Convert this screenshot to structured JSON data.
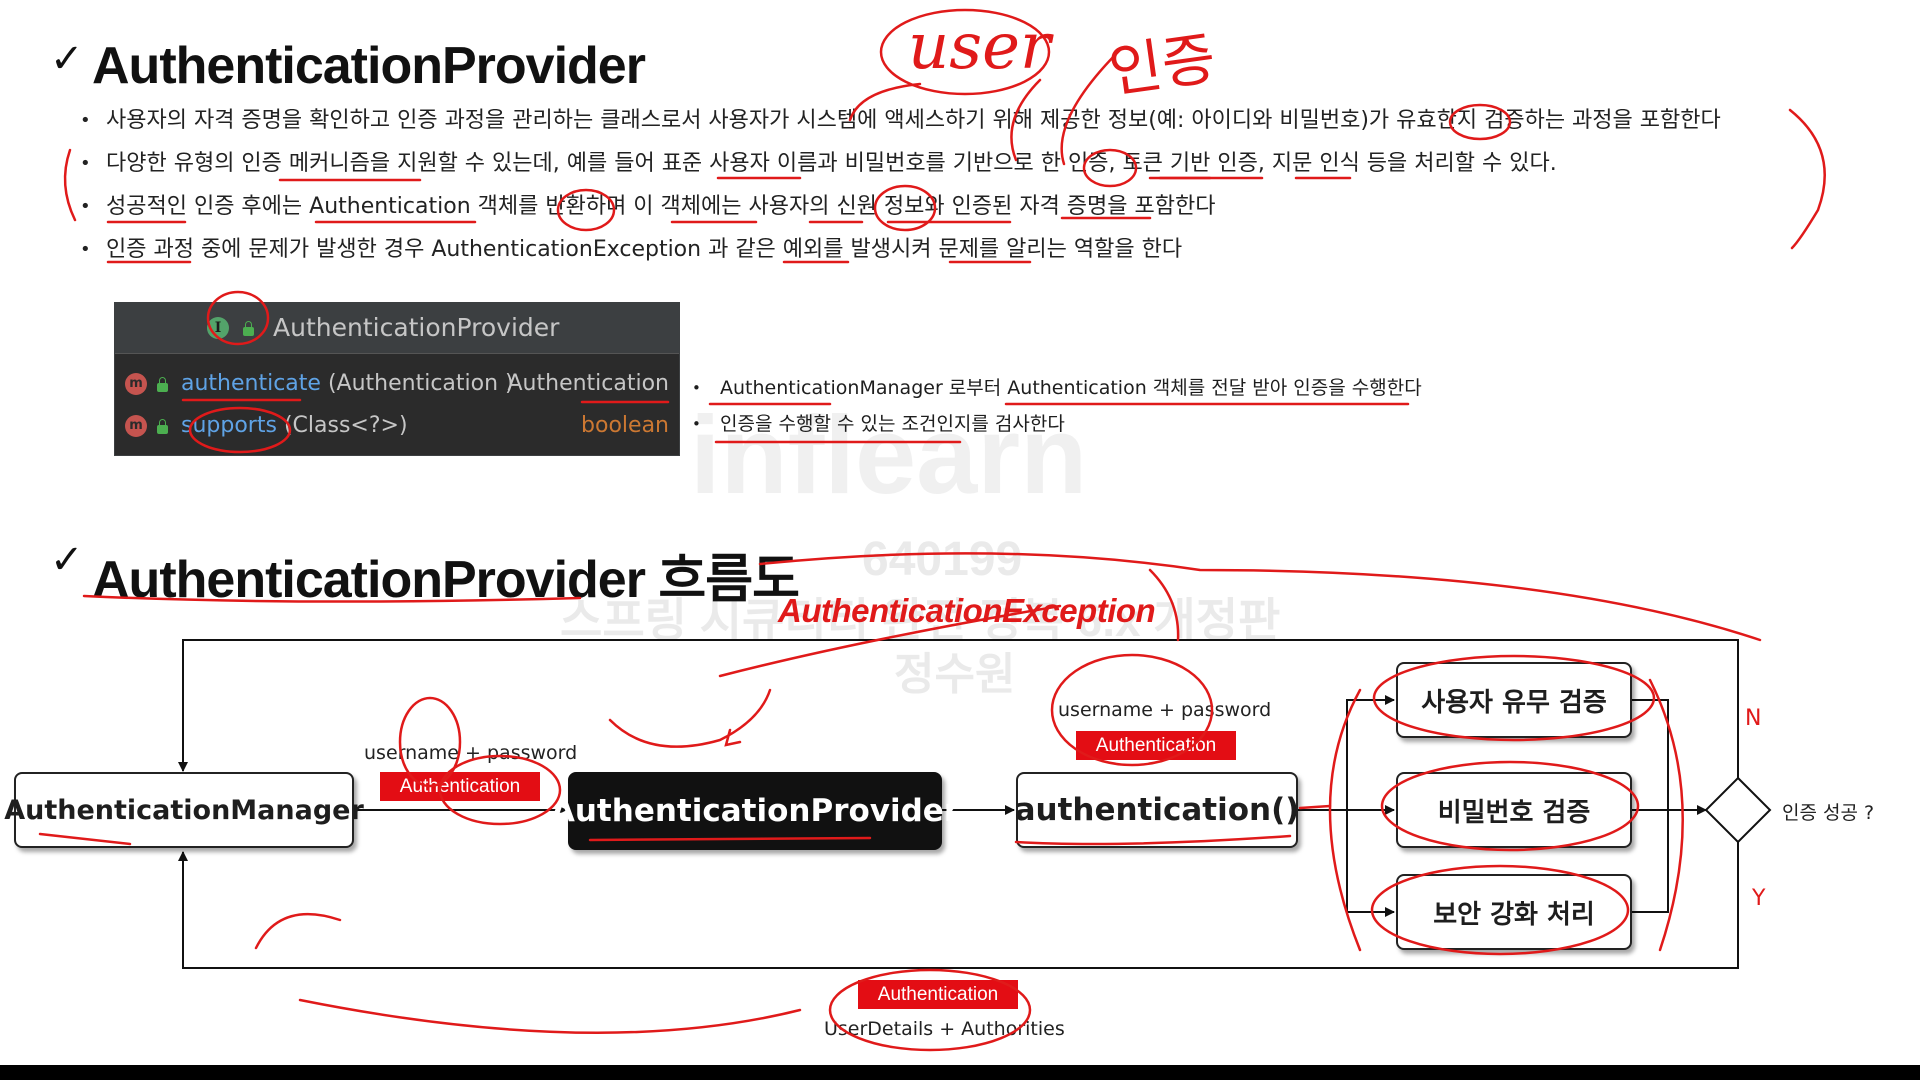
{
  "section1": {
    "title": "AuthenticationProvider",
    "bullets": [
      "사용자의 자격 증명을 확인하고 인증 과정을 관리하는 클래스로서  사용자가 시스템에 액세스하기 위해 제공한 정보(예: 아이디와 비밀번호)가 유효한지 검증하는 과정을 포함한다",
      "다양한 유형의 인증 메커니즘을 지원할 수 있는데, 예를 들어 표준 사용자 이름과 비밀번호를 기반으로 한 인증, 토큰 기반 인증, 지문 인식 등을 처리할 수 있다.",
      "성공적인 인증 후에는 Authentication 객체를 반환하며 이 객체에는 사용자의 신원 정보와 인증된 자격 증명을 포함한다",
      "인증 과정 중에 문제가 발생한 경우 AuthenticationException 과 같은 예외를 발생시켜 문제를 알리는 역할을 한다"
    ]
  },
  "ide": {
    "class_icon": "I",
    "method_icon": "m",
    "title": "AuthenticationProvider",
    "methods": [
      {
        "name": "authenticate",
        "params": "(Authentication )",
        "returns": "Authentication"
      },
      {
        "name": "supports",
        "params": "(Class<?>)",
        "returns": "boolean"
      }
    ],
    "descriptions": [
      "AuthenticationManager 로부터 Authentication 객체를 전달 받아 인증을 수행한다",
      "인증을 수행할 수 있는 조건인지를 검사한다"
    ]
  },
  "section2": {
    "title": "AuthenticationProvider 흐름도"
  },
  "flow": {
    "manager": "AuthenticationManager",
    "provider": "AuthenticationProvider",
    "method": "authentication()",
    "input_label": "username + password",
    "input_tag": "Authentication",
    "method_label": "username + password",
    "method_tag": "Authentication",
    "checks": [
      "사용자 유무 검증",
      "비밀번호 검증",
      "보안 강화 처리"
    ],
    "decision": "인증 성공 ?",
    "no": "N",
    "yes": "Y",
    "result_tag": "Authentication",
    "result_label": "UserDetails + Authorities",
    "exception": "AuthenticationException"
  },
  "handwriting": {
    "user": "user",
    "korean": "인증"
  },
  "watermark": {
    "logo": "inflearn",
    "id": "640199",
    "course": "스프링 시큐리티 완전 정복 6.x 개정판",
    "author": "정수원"
  },
  "colors": {
    "annotation_red": "#e01a1a",
    "tag_red": "#e30d14",
    "ide_bg": "#2b2b2b",
    "method_blue": "#5fa3e6",
    "return_orange": "#cc7832"
  }
}
